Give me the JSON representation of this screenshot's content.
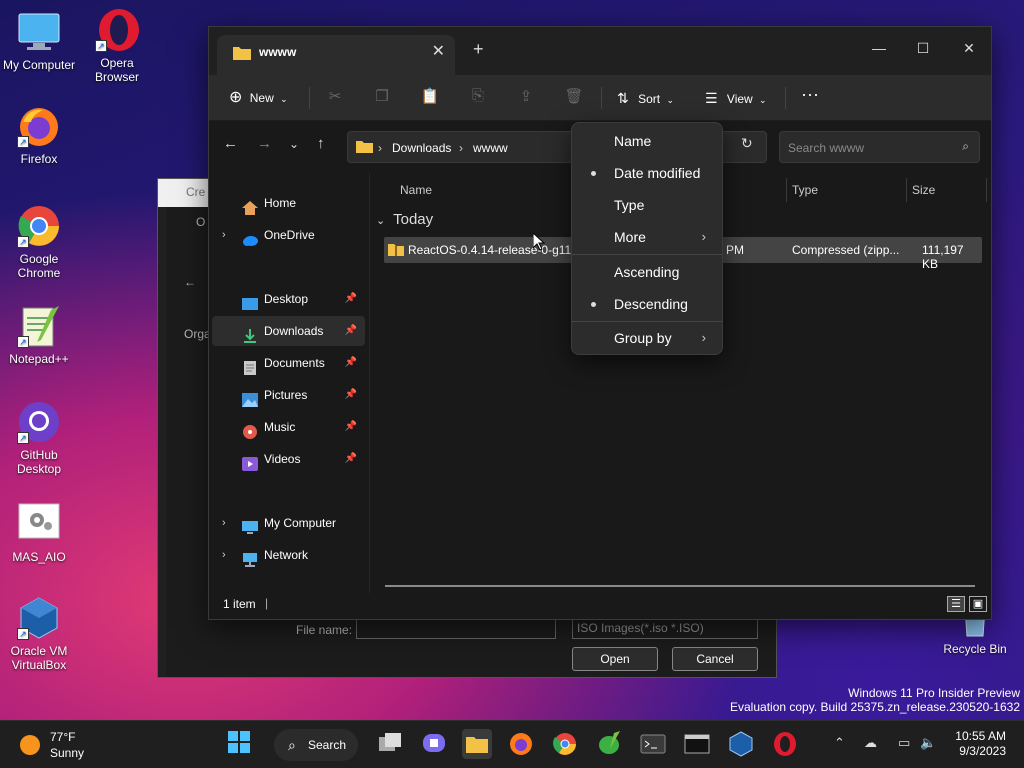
{
  "desktop": {
    "icons": [
      {
        "label": "My Computer"
      },
      {
        "label": "Opera Browser"
      },
      {
        "label": "Firefox"
      },
      {
        "label": "Google Chrome"
      },
      {
        "label": "Notepad++"
      },
      {
        "label": "GitHub Desktop"
      },
      {
        "label": "MAS_AIO"
      },
      {
        "label": "Oracle VM VirtualBox"
      },
      {
        "label": "Recycle Bin"
      }
    ],
    "watermark": {
      "line1": "Windows 11 Pro Insider Preview",
      "line2": "Evaluation copy. Build 25375.zn_release.230520-1632"
    }
  },
  "back_dialog": {
    "title": "Cre",
    "subtitle": "O",
    "organize": "Orga",
    "file_name_label": "File name:",
    "filter_value": "ISO Images(*.iso *.ISO)",
    "open_label": "Open",
    "cancel_label": "Cancel"
  },
  "explorer": {
    "tab_title": "wwww",
    "toolbar": {
      "new_label": "New",
      "sort_label": "Sort",
      "view_label": "View"
    },
    "address": {
      "crumbs": [
        "Downloads",
        "wwww"
      ]
    },
    "search_placeholder": "Search wwww",
    "sidebar": {
      "items": [
        {
          "label": "Home"
        },
        {
          "label": "OneDrive"
        },
        {
          "label": "Desktop"
        },
        {
          "label": "Downloads"
        },
        {
          "label": "Documents"
        },
        {
          "label": "Pictures"
        },
        {
          "label": "Music"
        },
        {
          "label": "Videos"
        },
        {
          "label": "My Computer"
        },
        {
          "label": "Network"
        }
      ]
    },
    "columns": {
      "name": "Name",
      "type": "Type",
      "size": "Size"
    },
    "group_label": "Today",
    "files": [
      {
        "name": "ReactOS-0.4.14-release-0-g11f",
        "date_fragment": "PM",
        "type": "Compressed (zipp...",
        "size": "111,197 KB"
      }
    ],
    "status": {
      "item_count": "1 item"
    }
  },
  "sort_menu": {
    "items": [
      {
        "label": "Name",
        "selected": false
      },
      {
        "label": "Date modified",
        "selected": true
      },
      {
        "label": "Type",
        "selected": false
      },
      {
        "label": "More",
        "submenu": true
      },
      {
        "label": "Ascending",
        "selected": false
      },
      {
        "label": "Descending",
        "selected": true
      },
      {
        "label": "Group by",
        "submenu": true
      }
    ]
  },
  "taskbar": {
    "weather": {
      "temp": "77°F",
      "condition": "Sunny"
    },
    "search_label": "Search",
    "clock": {
      "time": "10:55 AM",
      "date": "9/3/2023"
    }
  },
  "colors": {
    "accent": "#4cc2ff",
    "folder": "#f3c145",
    "menu_bg": "#2c2c2c",
    "explorer_bg": "#191919"
  }
}
